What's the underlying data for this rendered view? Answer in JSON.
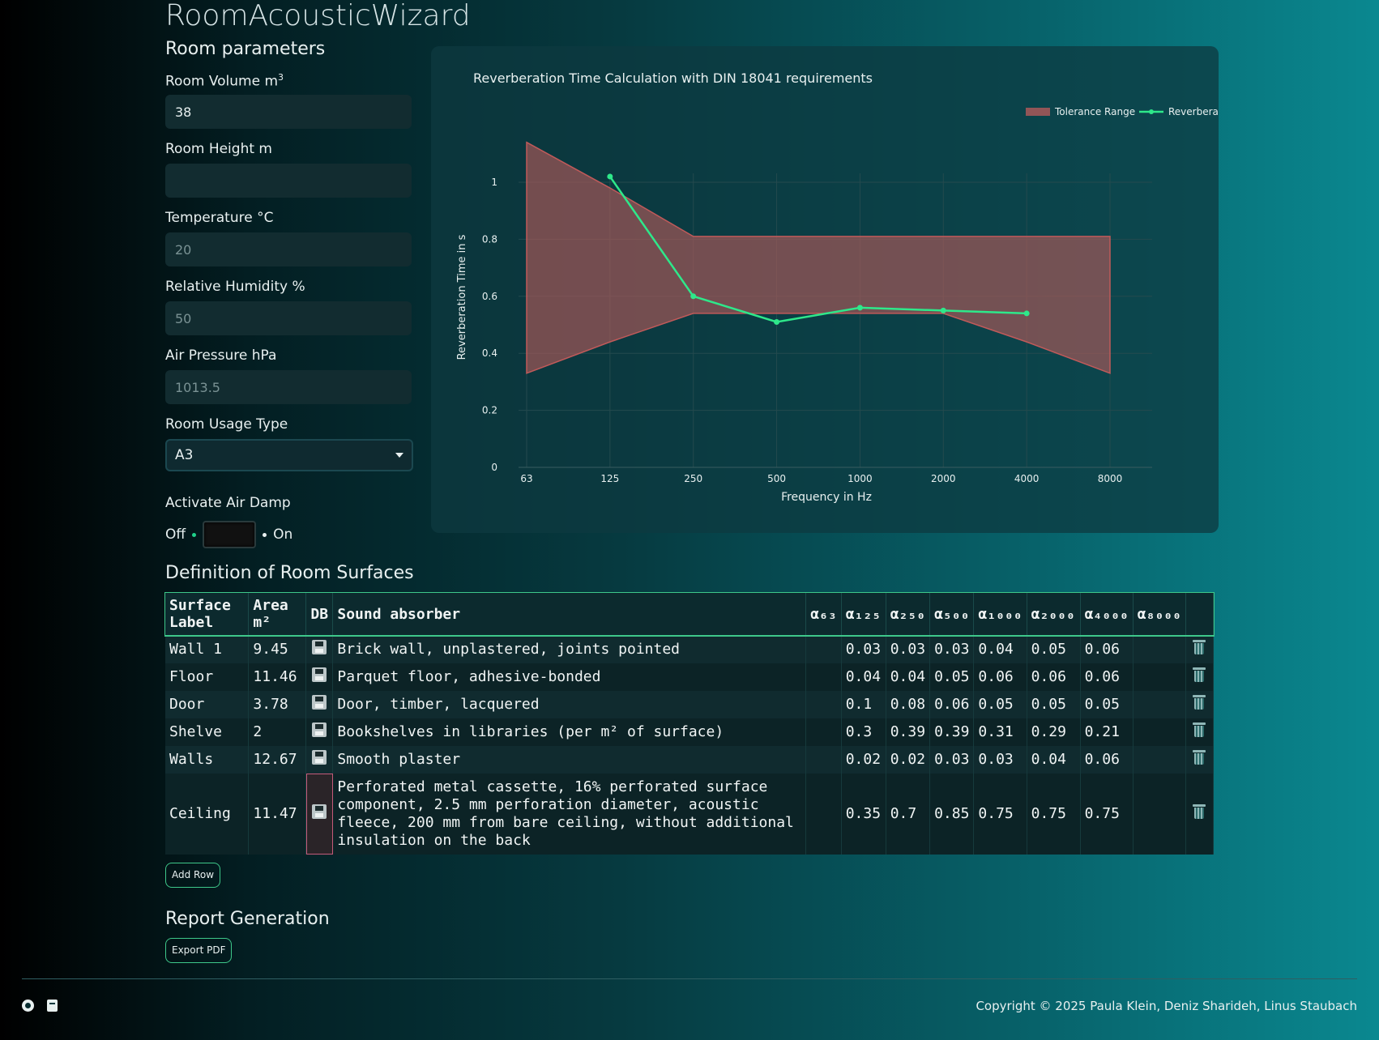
{
  "app": {
    "title": "RoomAcousticWizard"
  },
  "room": {
    "section_title": "Room parameters",
    "volume_label": "Room Volume m",
    "volume_sup": "3",
    "volume_value": "38",
    "height_label": "Room Height m",
    "height_value": "",
    "temperature_label": "Temperature °C",
    "temperature_placeholder": "20",
    "humidity_label": "Relative Humidity %",
    "humidity_placeholder": "50",
    "pressure_label": "Air Pressure hPa",
    "pressure_placeholder": "1013.5",
    "usage_label": "Room Usage Type",
    "usage_value": "A3",
    "airdamp_label": "Activate Air Damp",
    "airdamp_off": "Off",
    "airdamp_on": "On"
  },
  "chart_data": {
    "type": "line",
    "title": "Reverberation Time Calculation with DIN 18041 requirements",
    "xlabel": "Frequency in Hz",
    "ylabel": "Reverberation Time in s",
    "categories": [
      "63",
      "125",
      "250",
      "500",
      "1000",
      "2000",
      "4000",
      "8000"
    ],
    "yticks": [
      "0",
      "0.2",
      "0.4",
      "0.6",
      "0.8",
      "1"
    ],
    "ylim": [
      0,
      1.2
    ],
    "legend_position": "top-right",
    "grid": true,
    "series": [
      {
        "name": "Tolerance Range",
        "type": "area",
        "color": "#b45a5a",
        "upper": [
          1.14,
          0.98,
          0.81,
          0.81,
          0.81,
          0.81,
          0.81,
          0.81
        ],
        "lower": [
          0.33,
          0.44,
          0.54,
          0.54,
          0.54,
          0.54,
          0.44,
          0.33
        ]
      },
      {
        "name": "Reverberation Time",
        "type": "line",
        "color": "#2ee88a",
        "values": [
          null,
          1.02,
          0.6,
          0.51,
          0.56,
          0.55,
          0.54,
          null
        ]
      }
    ]
  },
  "surfaces": {
    "section_title": "Definition of Room Surfaces",
    "headers": [
      "Surface Label",
      "Area m²",
      "DB",
      "Sound absorber",
      "α₆₃",
      "α₁₂₅",
      "α₂₅₀",
      "α₅₀₀",
      "α₁₀₀₀",
      "α₂₀₀₀",
      "α₄₀₀₀",
      "α₈₀₀₀",
      ""
    ],
    "rows": [
      {
        "label": "Wall 1",
        "area": "9.45",
        "absorber": "Brick wall, unplastered, joints pointed",
        "a63": "",
        "a125": "0.03",
        "a250": "0.03",
        "a500": "0.03",
        "a1000": "0.04",
        "a2000": "0.05",
        "a4000": "0.06",
        "a8000": ""
      },
      {
        "label": "Floor",
        "area": "11.46",
        "absorber": "Parquet floor, adhesive-bonded",
        "a63": "",
        "a125": "0.04",
        "a250": "0.04",
        "a500": "0.05",
        "a1000": "0.06",
        "a2000": "0.06",
        "a4000": "0.06",
        "a8000": ""
      },
      {
        "label": "Door",
        "area": "3.78",
        "absorber": "Door, timber, lacquered",
        "a63": "",
        "a125": "0.1",
        "a250": "0.08",
        "a500": "0.06",
        "a1000": "0.05",
        "a2000": "0.05",
        "a4000": "0.05",
        "a8000": ""
      },
      {
        "label": "Shelve",
        "area": "2",
        "absorber": "Bookshelves in libraries (per m² of surface)",
        "a63": "",
        "a125": "0.3",
        "a250": "0.39",
        "a500": "0.39",
        "a1000": "0.31",
        "a2000": "0.29",
        "a4000": "0.21",
        "a8000": ""
      },
      {
        "label": "Walls",
        "area": "12.67",
        "absorber": "Smooth plaster",
        "a63": "",
        "a125": "0.02",
        "a250": "0.02",
        "a500": "0.03",
        "a1000": "0.03",
        "a2000": "0.04",
        "a4000": "0.06",
        "a8000": ""
      },
      {
        "label": "Ceiling",
        "area": "11.47",
        "absorber": "Perforated metal cassette, 16% perforated surface component, 2.5 mm perforation diameter, acoustic fleece, 200 mm from bare ceiling, without additional insulation on the back",
        "a63": "",
        "a125": "0.35",
        "a250": "0.7",
        "a500": "0.85",
        "a1000": "0.75",
        "a2000": "0.75",
        "a4000": "0.75",
        "a8000": ""
      }
    ],
    "add_row_label": "Add Row"
  },
  "report": {
    "section_title": "Report Generation",
    "export_label": "Export PDF"
  },
  "footer": {
    "copyright": "Copyright © 2025 Paula Klein, Deniz Sharideh, Linus Staubach"
  }
}
